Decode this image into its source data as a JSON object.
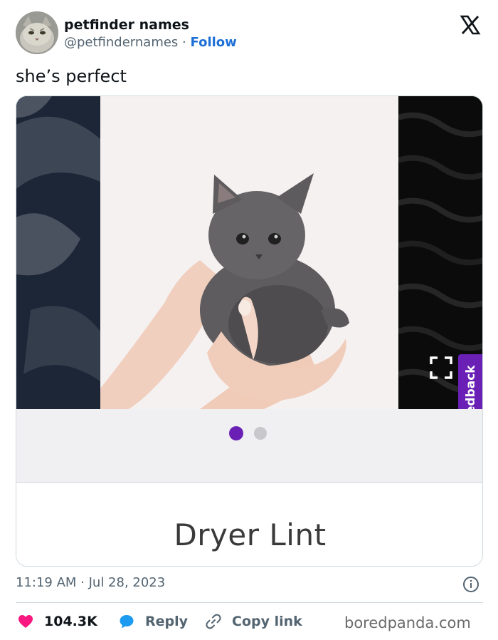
{
  "tweet": {
    "display_name": "petfinder names",
    "handle": "@petfindernames",
    "separator": "·",
    "follow_label": "Follow",
    "text": "she’s perfect",
    "timestamp": "11:19 AM · Jul 28, 2023"
  },
  "media": {
    "pet_name": "Dryer Lint",
    "feedback_label": "Feedback",
    "carousel": {
      "total": 2,
      "active_index": 0
    },
    "accent_color": "#6a1fb5"
  },
  "actions": {
    "like_count": "104.3K",
    "reply_label": "Reply",
    "copy_link_label": "Copy link"
  },
  "watermark": "boredpanda.com",
  "icons": {
    "brand": "x-logo-icon",
    "like": "heart-icon",
    "reply": "speech-bubble-icon",
    "copy": "link-icon",
    "info": "info-icon",
    "expand": "expand-icon"
  },
  "colors": {
    "like": "#f91880",
    "reply": "#1d9bf0",
    "follow": "#1d6fd6",
    "text_secondary": "#536471"
  }
}
